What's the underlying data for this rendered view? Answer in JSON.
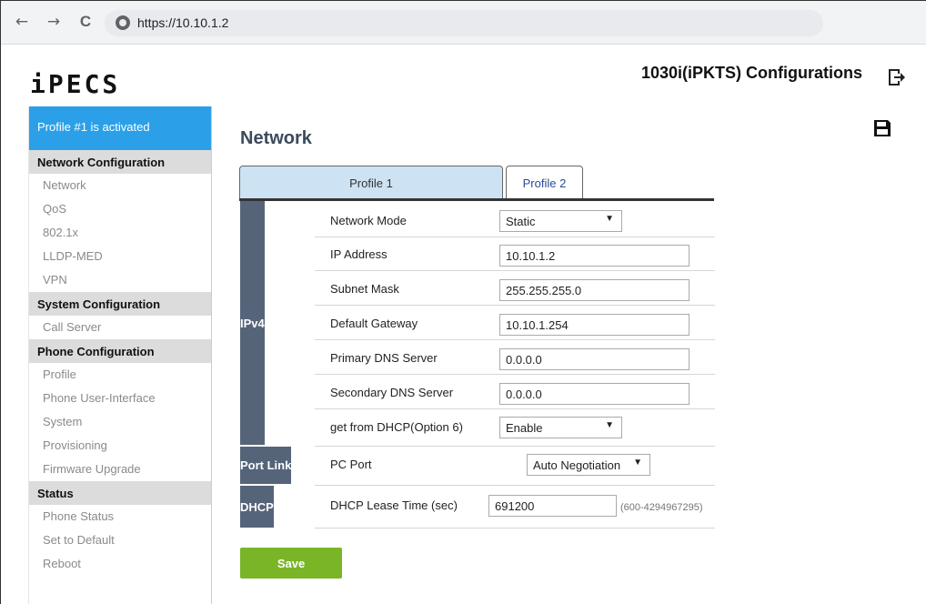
{
  "browser": {
    "back": "←",
    "forward": "→",
    "reload": "C",
    "url": "https://10.10.1.2"
  },
  "header": {
    "logo": "iPECS",
    "title": "1030i(iPKTS) Configurations"
  },
  "sidebar": {
    "banner": "Profile #1 is activated",
    "sections": [
      {
        "title": "Network Configuration",
        "items": [
          "Network",
          "QoS",
          "802.1x",
          "LLDP-MED",
          "VPN"
        ]
      },
      {
        "title": "System Configuration",
        "items": [
          "Call Server"
        ]
      },
      {
        "title": "Phone Configuration",
        "items": [
          "Profile",
          "Phone User-Interface",
          "System",
          "Provisioning",
          "Firmware Upgrade"
        ]
      },
      {
        "title": "Status",
        "items": [
          "Phone Status",
          "Set to Default",
          "Reboot"
        ]
      }
    ]
  },
  "main": {
    "title": "Network",
    "tabs": [
      "Profile 1",
      "Profile 2"
    ],
    "groups": {
      "ipv4": "IPv4",
      "port_link": "Port Link",
      "dhcp": "DHCP"
    },
    "fields": {
      "network_mode": {
        "label": "Network Mode",
        "value": "Static"
      },
      "ip_address": {
        "label": "IP Address",
        "value": "10.10.1.2"
      },
      "subnet_mask": {
        "label": "Subnet Mask",
        "value": "255.255.255.0"
      },
      "default_gateway": {
        "label": "Default Gateway",
        "value": "10.10.1.254"
      },
      "primary_dns": {
        "label": "Primary DNS Server",
        "value": "0.0.0.0"
      },
      "secondary_dns": {
        "label": "Secondary DNS Server",
        "value": "0.0.0.0"
      },
      "dhcp_option6": {
        "label": "get from DHCP(Option 6)",
        "value": "Enable"
      },
      "pc_port": {
        "label": "PC Port",
        "value": "Auto Negotiation"
      },
      "dhcp_lease": {
        "label": "DHCP Lease Time (sec)",
        "value": "691200",
        "hint": "(600-4294967295)"
      }
    },
    "save_label": "Save"
  },
  "icons": {
    "logout": "logout-icon",
    "save": "floppy-disk-icon",
    "site_info": "site-info-icon"
  },
  "colors": {
    "banner": "#2b9fe8",
    "group_bg": "#56647a",
    "save_button": "#7ab527",
    "active_tab": "#cde3f3"
  }
}
